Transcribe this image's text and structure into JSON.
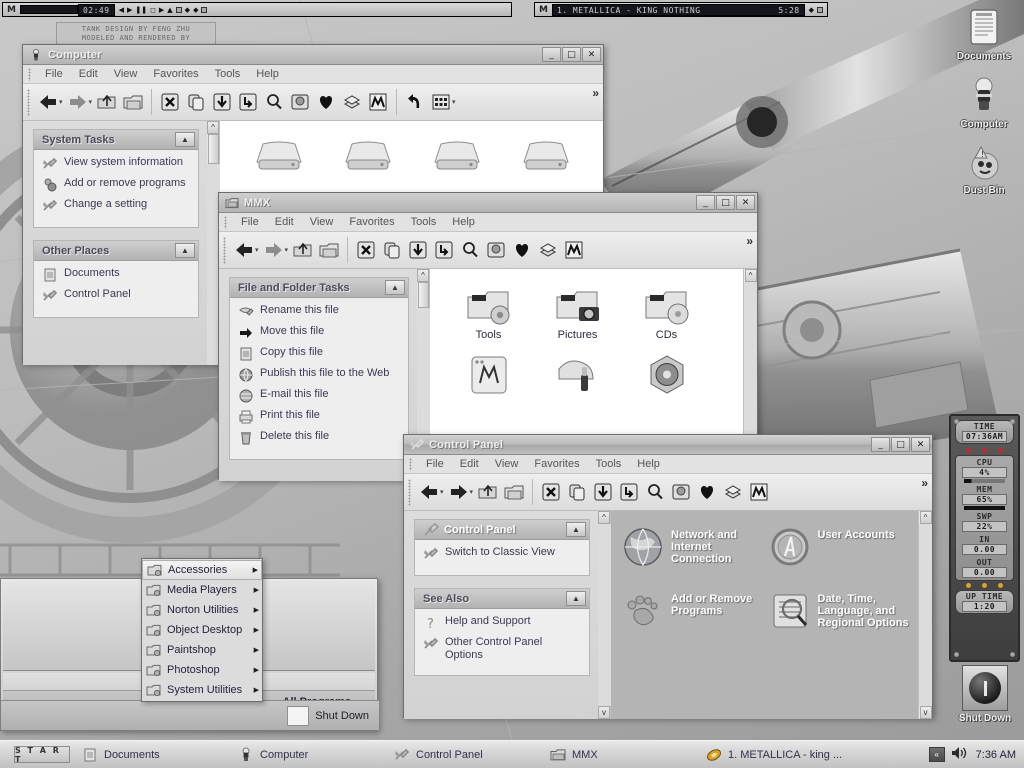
{
  "wallpaper": {
    "caption_line1": "TANK DESIGN BY FENG ZHU",
    "caption_line2": "MODELED AND RENDERED BY"
  },
  "winamp": {
    "logo": "M",
    "time": "02:49",
    "playlist_logo": "M",
    "track": "1. METALLICA - KING NOTHING",
    "track_time": "5:28"
  },
  "desktop_icons": [
    {
      "label": "Documents",
      "icon": "document-icon"
    },
    {
      "label": "Computer",
      "icon": "computer-icon"
    },
    {
      "label": "Dust Bin",
      "icon": "dustbin-icon"
    }
  ],
  "menus": [
    "File",
    "Edit",
    "View",
    "Favorites",
    "Tools",
    "Help"
  ],
  "toolbar_icons": [
    "back-arrow-icon",
    "forward-arrow-icon",
    "up-folder-icon",
    "folders-icon",
    "delete-x-icon",
    "copy-icon",
    "download-icon",
    "move-icon",
    "search-icon",
    "view-icon",
    "favorites-heart-icon",
    "history-stack-icon",
    "media-icon",
    "undo-icon",
    "views-grid-icon"
  ],
  "toolbar_overflow": "»",
  "windows": {
    "computer": {
      "title": "Computer",
      "icon": "computer-icon",
      "buttons": {
        "minimize": "_",
        "maximize": "□",
        "close": "✕"
      },
      "panels": [
        {
          "title": "System Tasks",
          "collapse": "▲",
          "tasks": [
            {
              "label": "View system information",
              "icon": "tools-icon"
            },
            {
              "label": "Add or remove programs",
              "icon": "add-remove-icon"
            },
            {
              "label": "Change a setting",
              "icon": "tools-icon"
            }
          ]
        },
        {
          "title": "Other Places",
          "collapse": "▲",
          "tasks": [
            {
              "label": "Documents",
              "icon": "document-icon"
            },
            {
              "label": "Control Panel",
              "icon": "tools-icon"
            }
          ]
        }
      ],
      "drives": [
        {
          "label": "",
          "icon": "drive-icon"
        },
        {
          "label": "",
          "icon": "drive-icon"
        },
        {
          "label": "",
          "icon": "drive-icon"
        },
        {
          "label": "",
          "icon": "drive-icon"
        }
      ]
    },
    "mmx": {
      "title": "MMX",
      "icon": "folder-icon",
      "buttons": {
        "minimize": "_",
        "maximize": "□",
        "close": "✕"
      },
      "panels": [
        {
          "title": "File and Folder Tasks",
          "collapse": "▲",
          "tasks": [
            {
              "label": "Rename this file",
              "icon": "rename-icon"
            },
            {
              "label": "Move this file",
              "icon": "move-arrow-icon"
            },
            {
              "label": "Copy this file",
              "icon": "copy-icon"
            },
            {
              "label": "Publish this file to the Web",
              "icon": "publish-web-icon"
            },
            {
              "label": "E-mail this file",
              "icon": "email-globe-icon"
            },
            {
              "label": "Print this file",
              "icon": "printer-icon"
            },
            {
              "label": "Delete this file",
              "icon": "trash-icon"
            }
          ]
        }
      ],
      "items": [
        {
          "label": "Tools",
          "icon": "folder-tools-icon"
        },
        {
          "label": "Pictures",
          "icon": "folder-camera-icon"
        },
        {
          "label": "CDs",
          "icon": "folder-cd-icon"
        },
        {
          "label": "",
          "icon": "media-player-icon"
        },
        {
          "label": "",
          "icon": "folder-lipstick-icon"
        },
        {
          "label": "",
          "icon": "speaker-icon"
        }
      ]
    },
    "control_panel": {
      "title": "Control Panel",
      "icon": "tools-icon",
      "buttons": {
        "minimize": "_",
        "maximize": "□",
        "close": "✕"
      },
      "panels": [
        {
          "title": "Control Panel",
          "collapse": "▲",
          "tasks": [
            {
              "label": "Switch to Classic View",
              "icon": "tools-icon"
            }
          ]
        },
        {
          "title": "See Also",
          "collapse": "▲",
          "tasks": [
            {
              "label": "Help and Support",
              "icon": "help-question-icon"
            },
            {
              "label": "Other Control Panel Options",
              "icon": "tools-icon"
            }
          ]
        }
      ],
      "categories": [
        {
          "label": "Network and Internet Connection",
          "icon": "globe-icon"
        },
        {
          "label": "User Accounts",
          "icon": "user-accounts-icon"
        },
        {
          "label": "Add or Remove Programs",
          "icon": "footprint-icon"
        },
        {
          "label": "Date, Time, Language, and Regional Options",
          "icon": "date-time-icon"
        }
      ]
    }
  },
  "start_menu": {
    "all_programs": "All Programs",
    "all_programs_chevron": "››",
    "shut_down": "Shut Down",
    "submenu": [
      {
        "label": "Accessories",
        "selected": true,
        "arrow": "▶"
      },
      {
        "label": "Media Players",
        "selected": false,
        "arrow": "▶"
      },
      {
        "label": "Norton Utilities",
        "selected": false,
        "arrow": "▶"
      },
      {
        "label": "Object Desktop",
        "selected": false,
        "arrow": "▶"
      },
      {
        "label": "Paintshop",
        "selected": false,
        "arrow": "▶"
      },
      {
        "label": "Photoshop",
        "selected": false,
        "arrow": "▶"
      },
      {
        "label": "System Utilities",
        "selected": false,
        "arrow": "▶"
      }
    ]
  },
  "taskbar": {
    "start": "S T A R T",
    "tasks": [
      {
        "label": "Documents",
        "icon": "document-icon"
      },
      {
        "label": "Computer",
        "icon": "computer-icon"
      },
      {
        "label": "Control Panel",
        "icon": "tools-icon"
      },
      {
        "label": "MMX",
        "icon": "folder-icon"
      },
      {
        "label": "1. METALLICA - king ...",
        "icon": "winamp-icon"
      }
    ],
    "tray_chevron": "«",
    "volume_icon": "speaker-volume-icon",
    "clock": "7:36 AM"
  },
  "sysmon": {
    "time_label": "TIME",
    "time_value": "07:36AM",
    "rows": [
      {
        "label": "CPU",
        "value": "4%"
      },
      {
        "label": "MEM",
        "value": "65%"
      },
      {
        "label": "SWP",
        "value": "22%"
      },
      {
        "label": "IN",
        "value": "0.00"
      },
      {
        "label": "OUT",
        "value": "0.00"
      }
    ],
    "uptime_label": "UP TIME",
    "uptime_value": "1:20",
    "shutdown_label": "Shut Down",
    "led_red": "#c62a2a",
    "led_amber": "#d8a326"
  }
}
